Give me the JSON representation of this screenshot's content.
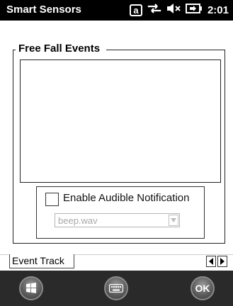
{
  "statusbar": {
    "title": "Smart Sensors",
    "input_mode": "a",
    "time": "2:01"
  },
  "group": {
    "title": "Free Fall Events"
  },
  "notification": {
    "checkbox_label": "Enable Audible Notification",
    "sound_selected": "beep.wav"
  },
  "tabs": [
    {
      "label": "Event Track"
    }
  ],
  "softkeys": {
    "ok_label": "OK"
  },
  "icons": [
    "connection-icon",
    "volume-muted-icon",
    "battery-icon",
    "windows-start-icon",
    "keyboard-icon",
    "chevron-left-icon",
    "chevron-right-icon",
    "chevron-down-icon"
  ]
}
